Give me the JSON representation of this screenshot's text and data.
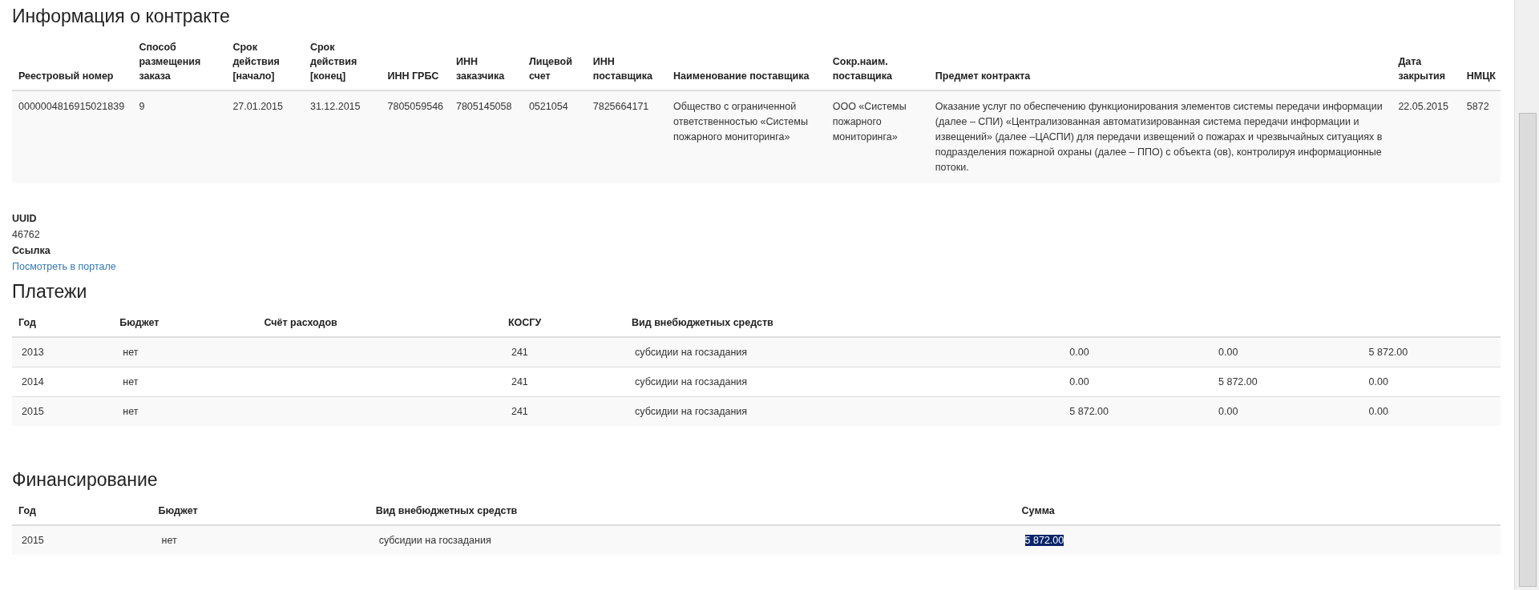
{
  "contract": {
    "title": "Информация о контракте",
    "columns": [
      "Реестровый номер",
      "Способ размещения заказа",
      "Срок действия [начало]",
      "Срок действия [конец]",
      "ИНН ГРБС",
      "ИНН заказчика",
      "Лицевой счет",
      "ИНН поставщика",
      "Наименование поставщика",
      "Сокр.наим. поставщика",
      "Предмет контракта",
      "Дата закрытия",
      "НМЦК"
    ],
    "rows": [
      [
        "0000004816915021839",
        "9",
        "27.01.2015",
        "31.12.2015",
        "7805059546",
        "7805145058",
        "0521054",
        "7825664171",
        "Общество с ограниченной ответственностью «Системы пожарного мониторинга»",
        "ООО «Системы пожарного мониторинга»",
        "Оказание услуг по обеспечению функционирования элементов системы передачи информации (далее – СПИ) «Централизованная автоматизированная система передачи информации и извещений» (далее –ЦАСПИ) для передачи извещений о пожарах и чрезвычайных ситуациях в подразделения пожарной охраны (далее – ППО) с объекта (ов), контролируя информационные потоки.",
        "22.05.2015",
        "5872"
      ]
    ]
  },
  "details": [
    {
      "kind": "text",
      "label": "UUID",
      "value": "46762"
    },
    {
      "kind": "link",
      "label": "Ссылка",
      "value": "Посмотреть в портале"
    }
  ],
  "payments": {
    "title": "Платежи",
    "columns": [
      "Год",
      "Бюджет",
      "Счёт расходов",
      "КОСГУ",
      "Вид внебюджетных средств"
    ],
    "rows": [
      {
        "year": "2013",
        "budget": "нет",
        "kosgu": "241",
        "fund_type": "субсидии на госзадания",
        "column_6": "0.00",
        "column_7": "0.00",
        "column_8": "5 872.00"
      },
      {
        "year": "2014",
        "budget": "нет",
        "kosgu": "241",
        "fund_type": "субсидии на госзадания",
        "column_6": "0.00",
        "column_7": "5 872.00",
        "column_8": "0.00"
      },
      {
        "year": "2015",
        "budget": "нет",
        "kosgu": "241",
        "fund_type": "субсидии на госзадания",
        "column_6": "5 872.00",
        "column_7": "0.00",
        "column_8": "0.00"
      }
    ]
  },
  "funding": {
    "title": "Финансирование",
    "columns": [
      "Год",
      "Бюджет",
      "Вид внебюджетных средств",
      "Сумма"
    ],
    "rows": [
      {
        "year": "2015",
        "budget": "нет",
        "fund_type": "субсидии на госзадания",
        "sum": "5 872.00",
        "sum_selected": true
      }
    ]
  }
}
